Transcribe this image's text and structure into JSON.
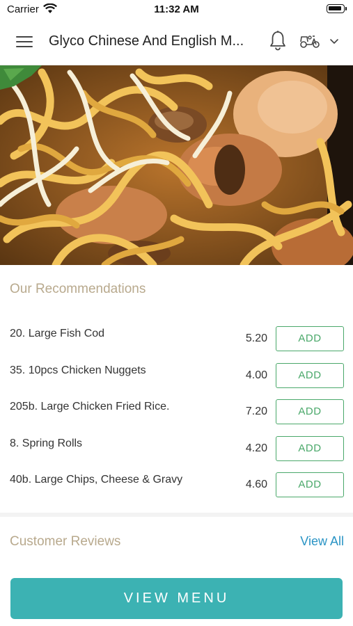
{
  "status_bar": {
    "carrier": "Carrier",
    "time": "11:32 AM"
  },
  "nav": {
    "title": "Glyco Chinese And English M...",
    "menu_icon": "hamburger-menu-icon",
    "bell_icon": "bell-icon",
    "delivery_icon": "scooter-icon",
    "dropdown_icon": "chevron-down-icon"
  },
  "hero": {
    "image": "noodles-with-chicken-and-mushrooms"
  },
  "recommendations": {
    "title": "Our Recommendations",
    "items": [
      {
        "name": "20. Large Fish Cod",
        "price": "5.20",
        "button": "ADD"
      },
      {
        "name": "35. 10pcs Chicken Nuggets",
        "price": "4.00",
        "button": "ADD"
      },
      {
        "name": "205b. Large Chicken Fried Rice.",
        "price": "7.20",
        "button": "ADD"
      },
      {
        "name": "8. Spring Rolls",
        "price": "4.20",
        "button": "ADD"
      },
      {
        "name": "40b. Large Chips, Cheese & Gravy",
        "price": "4.60",
        "button": "ADD"
      }
    ]
  },
  "reviews": {
    "title": "Customer Reviews",
    "view_all": "View All"
  },
  "view_menu_button": "VIEW MENU",
  "colors": {
    "section_title": "#b8a98d",
    "add_green": "#4aa86a",
    "link_blue": "#2a94c5",
    "primary_teal": "#3cb2b3"
  }
}
